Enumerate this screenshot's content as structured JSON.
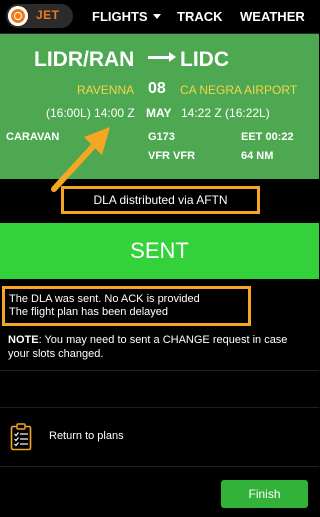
{
  "nav": {
    "logo_text": "JET",
    "flights_label": "FLIGHTS",
    "track_label": "TRACK",
    "weather_label": "WEATHER"
  },
  "flight": {
    "from": "LIDR/RAN",
    "to": "LIDC",
    "departure_name": "RAVENNA",
    "arrival_name": "CA NEGRA AIRPORT",
    "day": "08",
    "month": "MAY",
    "departure_time": "(16:00L) 14:00 Z",
    "arrival_time": "14:22 Z (16:22L)",
    "aircraft_type": "CARAVAN",
    "callsign": "G173",
    "flight_rules": "VFR VFR",
    "eet": "EET 00:22",
    "distance": "64 NM"
  },
  "distribution": {
    "text": "DLA distributed via AFTN"
  },
  "status": {
    "banner": "SENT",
    "line1": "The DLA was sent. No ACK is provided",
    "line2": "The flight plan has been delayed"
  },
  "note": {
    "label": "NOTE",
    "text": ": You may need to sent a CHANGE request in case your slots changed."
  },
  "actions": {
    "return_label": "Return to plans",
    "finish_label": "Finish"
  },
  "colors": {
    "panel_green": "#4ea852",
    "sent_green": "#33d13a",
    "finish_green": "#33b23a",
    "highlight_orange": "#f5a623",
    "airport_yellow": "#f5d44a",
    "brand_orange": "#f07a1a"
  }
}
